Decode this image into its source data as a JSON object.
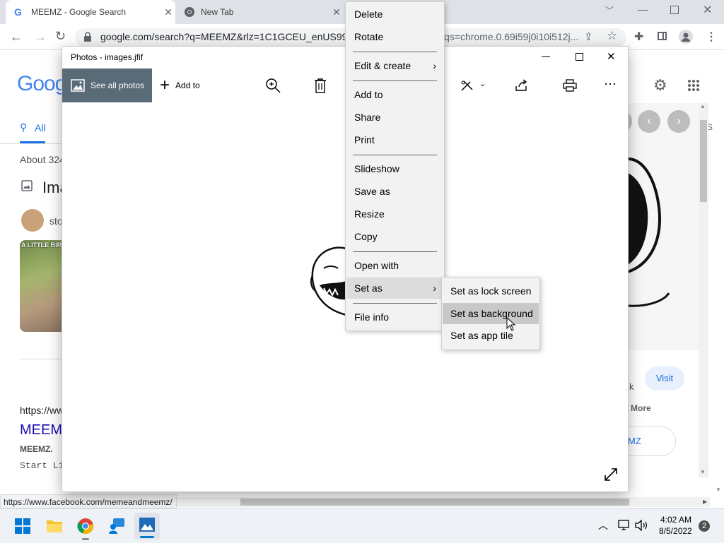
{
  "browser": {
    "tabs": [
      {
        "title": "MEEMZ - Google Search"
      },
      {
        "title": "New Tab"
      }
    ],
    "url": "google.com/search?q=MEEMZ&rlz=1C1GCEU_enUS992",
    "url_tail": "qs=chrome.0.69i59j0i10i512j...",
    "status_url": "https://www.facebook.com/memeandmeemz/"
  },
  "google": {
    "logo": "Goog",
    "tab_all": "All",
    "about": "About 324",
    "images_heading": "Ima",
    "chip_text": "sto",
    "meme_text": "A LITTLE BIRD",
    "result_url": "https://ww",
    "result_title": "MEEM",
    "result_bold": "MEEMZ.",
    "result_snippet": "Start Li",
    "side_s": "S",
    "side_k": "k",
    "visit": "Visit",
    "more": "More",
    "side_mz": "MZ"
  },
  "photos": {
    "title": "Photos - images.jfif",
    "see_all": "See all photos",
    "add_to": "Add to"
  },
  "context_menu": {
    "items": [
      "Delete",
      "Rotate",
      "Edit & create",
      "Add to",
      "Share",
      "Print",
      "Slideshow",
      "Save as",
      "Resize",
      "Copy",
      "Open with",
      "Set as",
      "File info"
    ]
  },
  "submenu": {
    "items": [
      "Set as lock screen",
      "Set as background",
      "Set as app tile"
    ]
  },
  "taskbar": {
    "time": "4:02 AM",
    "date": "8/5/2022",
    "notifications": "2"
  },
  "colors": {
    "chrome_tabstrip": "#dee1e6",
    "google_blue": "#4285f4",
    "link_blue": "#1a0dab",
    "photos_accent": "#5a6b78",
    "menu_bg": "#f2f2f2",
    "menu_highlight": "#c8c8c8"
  }
}
